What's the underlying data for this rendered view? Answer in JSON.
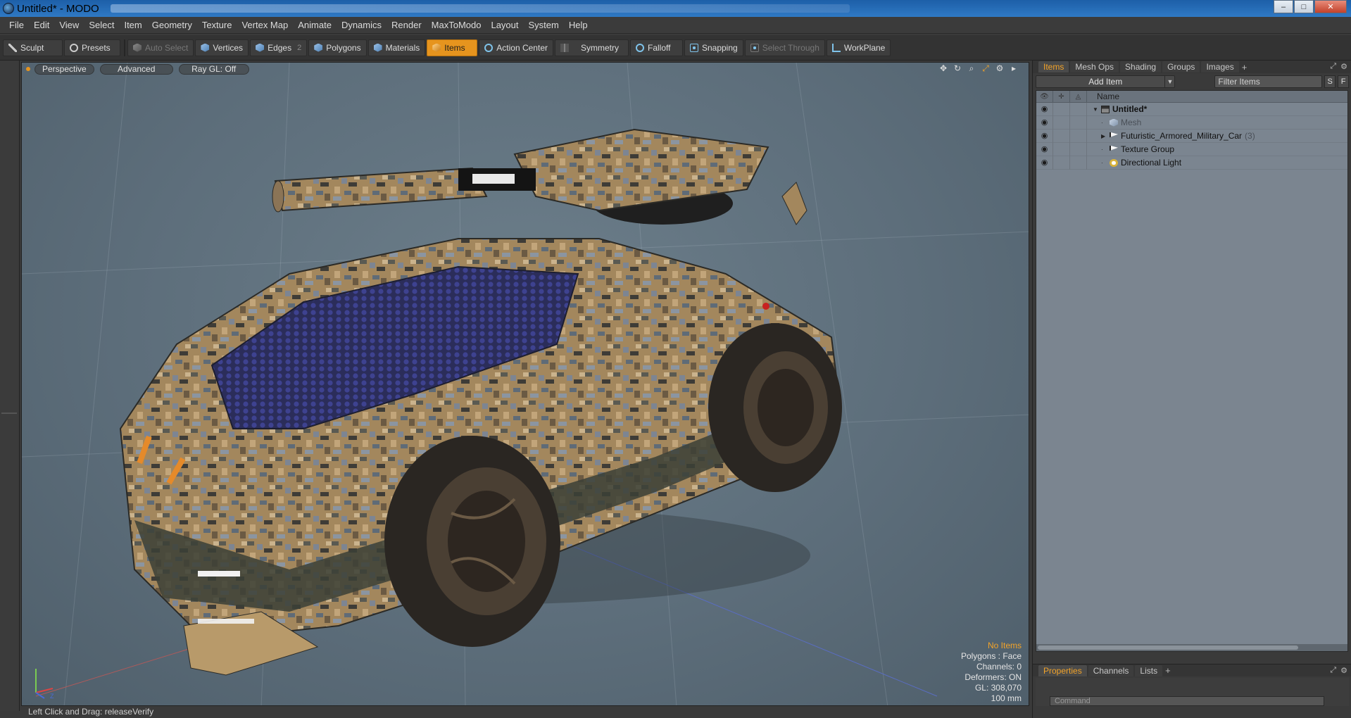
{
  "window": {
    "title": "Untitled* - MODO",
    "minimize": "–",
    "maximize": "□",
    "close": "✕"
  },
  "menu": [
    "File",
    "Edit",
    "View",
    "Select",
    "Item",
    "Geometry",
    "Texture",
    "Vertex Map",
    "Animate",
    "Dynamics",
    "Render",
    "MaxToModo",
    "Layout",
    "System",
    "Help"
  ],
  "toolbar": {
    "sculpt": "Sculpt",
    "presets": "Presets",
    "auto_select": "Auto Select",
    "vertices": "Vertices",
    "edges": "Edges",
    "edges_count": "2",
    "polygons": "Polygons",
    "materials": "Materials",
    "items": "Items",
    "action_center": "Action Center",
    "symmetry": "Symmetry",
    "falloff": "Falloff",
    "snapping": "Snapping",
    "select_through": "Select Through",
    "workplane": "WorkPlane"
  },
  "viewport": {
    "view_mode": "Perspective",
    "shading": "Advanced",
    "raygl": "Ray GL: Off",
    "icons": [
      "move-view-icon",
      "rotate-view-icon",
      "zoom-view-icon",
      "fit-view-icon",
      "settings-icon",
      "play-icon"
    ],
    "info": {
      "no_items": "No Items",
      "polygons": "Polygons : Face",
      "channels": "Channels: 0",
      "deformers": "Deformers: ON",
      "gl": "GL: 308,070",
      "scale": "100 mm"
    },
    "axis": {
      "x": "X",
      "y": "Y",
      "z": "Z"
    }
  },
  "status": {
    "hint": "Left Click and Drag:  releaseVerify"
  },
  "items_panel": {
    "tabs": [
      "Items",
      "Mesh Ops",
      "Shading",
      "Groups",
      "Images"
    ],
    "active_tab": "Items",
    "add_item": "Add Item",
    "filter_placeholder": "Filter Items",
    "s_label": "S",
    "f_label": "F",
    "column_name": "Name",
    "rows": [
      {
        "label": "Untitled*",
        "icon": "scene-icon",
        "kind": "scene"
      },
      {
        "label": "Mesh",
        "icon": "mesh-icon",
        "kind": "mesh"
      },
      {
        "label": "Futuristic_Armored_Military_Car",
        "count": "(3)",
        "icon": "group-icon",
        "kind": "group"
      },
      {
        "label": "Texture Group",
        "icon": "group-icon",
        "kind": "group"
      },
      {
        "label": "Directional Light",
        "icon": "light-icon",
        "kind": "light"
      }
    ]
  },
  "properties_panel": {
    "tabs": [
      "Properties",
      "Channels",
      "Lists"
    ],
    "active_tab": "Properties",
    "command_placeholder": "Command"
  },
  "colors": {
    "accent": "#e6941e",
    "viewport_bg": "#5d6e7b",
    "tree_bg": "#7b8590"
  }
}
